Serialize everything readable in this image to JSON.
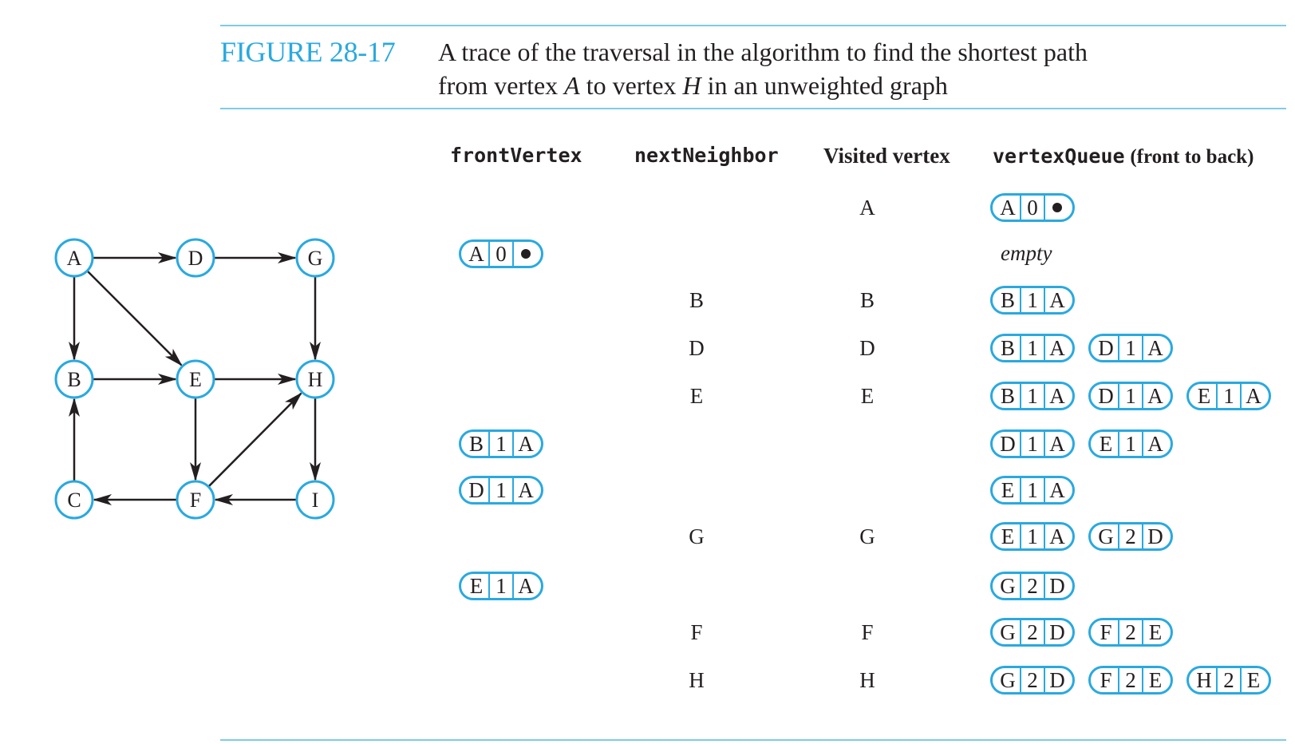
{
  "figure": {
    "number": "FIGURE 28-17",
    "caption_line1": "A trace of the traversal in the algorithm to find the shortest path",
    "caption_line2_pre": "from vertex ",
    "caption_v1": "A",
    "caption_line2_mid": " to vertex ",
    "caption_v2": "H",
    "caption_line2_post": " in an unweighted graph"
  },
  "headers": {
    "front_vertex": "frontVertex",
    "next_neighbor": "nextNeighbor",
    "visited_vertex": "Visited vertex",
    "vertex_queue": "vertexQueue",
    "vertex_queue_note": "(front to back)"
  },
  "graph": {
    "vertices": [
      "A",
      "D",
      "G",
      "B",
      "E",
      "H",
      "C",
      "F",
      "I"
    ],
    "edges": [
      [
        "A",
        "D"
      ],
      [
        "D",
        "G"
      ],
      [
        "A",
        "B"
      ],
      [
        "A",
        "E"
      ],
      [
        "G",
        "H"
      ],
      [
        "B",
        "E"
      ],
      [
        "E",
        "H"
      ],
      [
        "E",
        "F"
      ],
      [
        "F",
        "H"
      ],
      [
        "H",
        "I"
      ],
      [
        "C",
        "B"
      ],
      [
        "F",
        "C"
      ],
      [
        "I",
        "F"
      ]
    ]
  },
  "trace": [
    {
      "front": null,
      "neighbor": "",
      "visited": "A",
      "queue": [
        [
          "A",
          "0",
          "•"
        ]
      ]
    },
    {
      "front": [
        "A",
        "0",
        "•"
      ],
      "neighbor": "",
      "visited": "",
      "queue": [],
      "queue_text": "empty"
    },
    {
      "front": null,
      "neighbor": "B",
      "visited": "B",
      "queue": [
        [
          "B",
          "1",
          "A"
        ]
      ]
    },
    {
      "front": null,
      "neighbor": "D",
      "visited": "D",
      "queue": [
        [
          "B",
          "1",
          "A"
        ],
        [
          "D",
          "1",
          "A"
        ]
      ]
    },
    {
      "front": null,
      "neighbor": "E",
      "visited": "E",
      "queue": [
        [
          "B",
          "1",
          "A"
        ],
        [
          "D",
          "1",
          "A"
        ],
        [
          "E",
          "1",
          "A"
        ]
      ]
    },
    {
      "front": [
        "B",
        "1",
        "A"
      ],
      "neighbor": "",
      "visited": "",
      "queue": [
        [
          "D",
          "1",
          "A"
        ],
        [
          "E",
          "1",
          "A"
        ]
      ]
    },
    {
      "front": [
        "D",
        "1",
        "A"
      ],
      "neighbor": "",
      "visited": "",
      "queue": [
        [
          "E",
          "1",
          "A"
        ]
      ]
    },
    {
      "front": null,
      "neighbor": "G",
      "visited": "G",
      "queue": [
        [
          "E",
          "1",
          "A"
        ],
        [
          "G",
          "2",
          "D"
        ]
      ]
    },
    {
      "front": [
        "E",
        "1",
        "A"
      ],
      "neighbor": "",
      "visited": "",
      "queue": [
        [
          "G",
          "2",
          "D"
        ]
      ]
    },
    {
      "front": null,
      "neighbor": "F",
      "visited": "F",
      "queue": [
        [
          "G",
          "2",
          "D"
        ],
        [
          "F",
          "2",
          "E"
        ]
      ]
    },
    {
      "front": null,
      "neighbor": "H",
      "visited": "H",
      "queue": [
        [
          "G",
          "2",
          "D"
        ],
        [
          "F",
          "2",
          "E"
        ],
        [
          "H",
          "2",
          "E"
        ]
      ]
    }
  ],
  "colors": {
    "accent": "#29a9e0",
    "rule": "#7fcbe6",
    "ink": "#231f20"
  }
}
